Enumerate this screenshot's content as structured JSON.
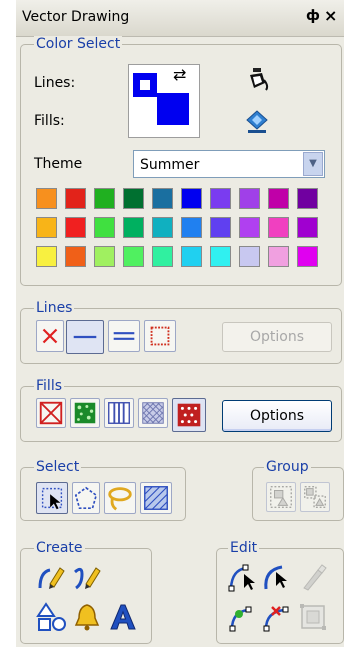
{
  "window": {
    "title": "Vector Drawing",
    "pin_glyph": "ф",
    "close_glyph": "×"
  },
  "color_select": {
    "legend": "Color Select",
    "lines_label": "Lines:",
    "fills_label": "Fills:",
    "swap_glyph": "⇄",
    "line_color": "#0000f0",
    "fill_color": "#0000f0",
    "theme_label": "Theme",
    "theme_value": "Summer",
    "palette": [
      [
        "#f7901e",
        "#e2231a",
        "#20b020",
        "#007030",
        "#1a6fa0",
        "#0000f0",
        "#7a3cf0",
        "#a040e8",
        "#c000a8",
        "#7000a0"
      ],
      [
        "#f8b418",
        "#f02020",
        "#40e040",
        "#00b060",
        "#10b0c0",
        "#2080f0",
        "#6040f0",
        "#b040f0",
        "#f040c0",
        "#a000d0"
      ],
      [
        "#f8f040",
        "#f06018",
        "#a0f060",
        "#50f060",
        "#30f0a0",
        "#20d0f0",
        "#30f0f0",
        "#c8c8f0",
        "#f0a0e0",
        "#e000f0"
      ]
    ]
  },
  "lines": {
    "legend": "Lines",
    "options_label": "Options"
  },
  "fills": {
    "legend": "Fills",
    "options_label": "Options"
  },
  "select": {
    "legend": "Select"
  },
  "group": {
    "legend": "Group"
  },
  "create": {
    "legend": "Create"
  },
  "edit": {
    "legend": "Edit"
  }
}
